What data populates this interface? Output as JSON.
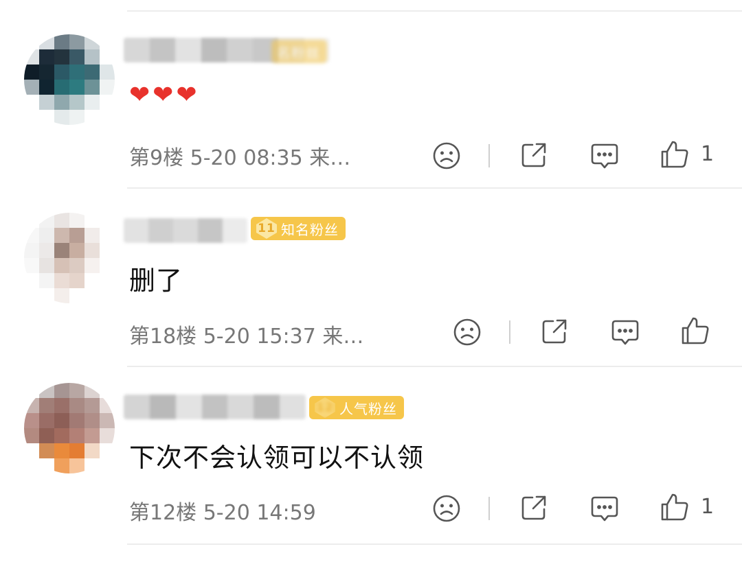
{
  "comments": [
    {
      "badge": {
        "level": "",
        "label": "名粉丝"
      },
      "content": "❤❤❤",
      "meta": "第9楼 5-20 08:35 来…",
      "like_count": "1"
    },
    {
      "badge": {
        "level": "11",
        "label": "知名粉丝"
      },
      "content": "删了",
      "meta": "第18楼 5-20 15:37 来…",
      "like_count": ""
    },
    {
      "badge": {
        "level": "12",
        "label": "人气粉丝"
      },
      "content": "下次不会认领可以不认领",
      "meta": "第12楼 5-20 14:59",
      "like_count": "1"
    }
  ],
  "icons": {
    "dislike": "sad-face-icon",
    "share": "share-icon",
    "reply": "comment-icon",
    "like": "thumbs-up-icon"
  },
  "colors": {
    "badge": "#f6c64a",
    "heart": "#e8322c",
    "meta_text": "#777777",
    "icon": "#555555"
  }
}
